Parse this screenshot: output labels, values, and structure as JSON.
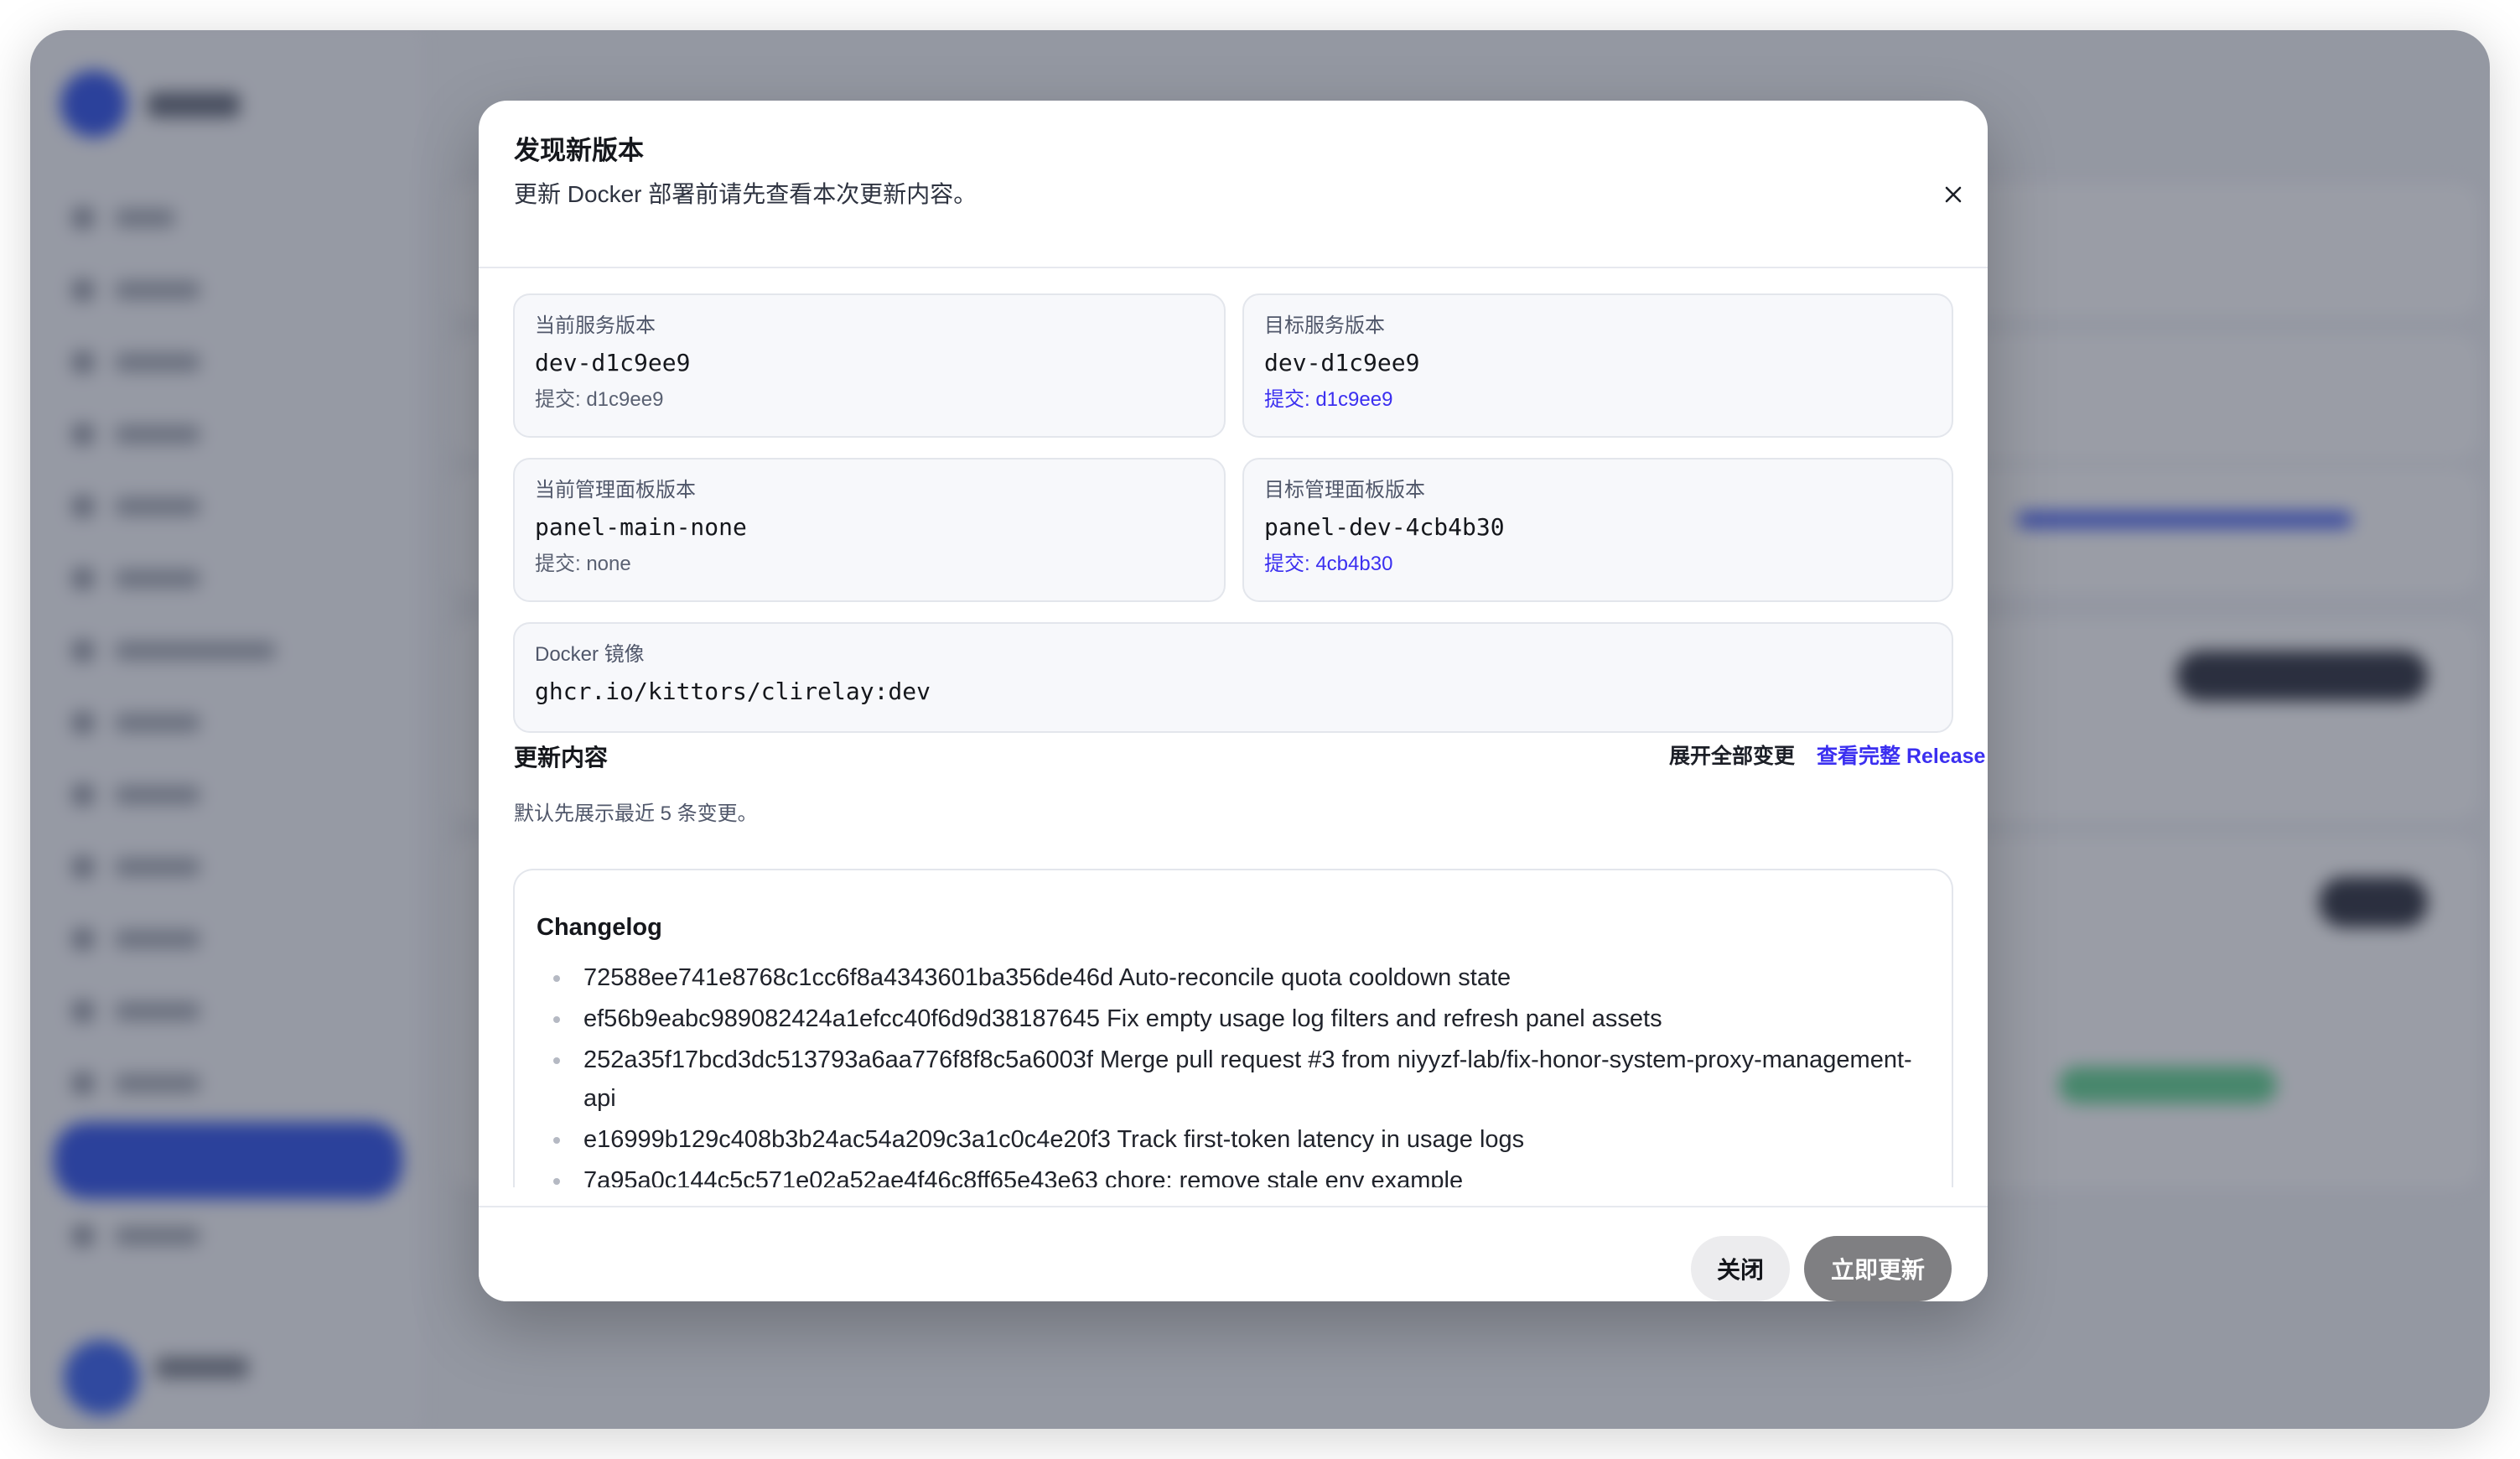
{
  "dialog": {
    "title": "发现新版本",
    "subtitle": "更新 Docker 部署前请先查看本次更新内容。",
    "close_icon": "close-icon"
  },
  "versions": {
    "current_service": {
      "label": "当前服务版本",
      "value": "dev-d1c9ee9",
      "commit": "提交: d1c9ee9"
    },
    "target_service": {
      "label": "目标服务版本",
      "value": "dev-d1c9ee9",
      "commit": "提交: d1c9ee9"
    },
    "current_panel": {
      "label": "当前管理面板版本",
      "value": "panel-main-none",
      "commit": "提交: none"
    },
    "target_panel": {
      "label": "目标管理面板版本",
      "value": "panel-dev-4cb4b30",
      "commit": "提交: 4cb4b30"
    },
    "docker_image": {
      "label": "Docker 镜像",
      "value": "ghcr.io/kittors/clirelay:dev"
    }
  },
  "changes": {
    "section_title": "更新内容",
    "expand_all": "展开全部变更",
    "view_release": "查看完整 Release",
    "hint": "默认先展示最近 5 条变更。",
    "changelog_title": "Changelog",
    "items": [
      "72588ee741e8768c1cc6f8a4343601ba356de46d Auto-reconcile quota cooldown state",
      "ef56b9eabc989082424a1efcc40f6d9d38187645 Fix empty usage log filters and refresh panel assets",
      "252a35f17bcd3dc513793a6aa776f8f8c5a6003f Merge pull request #3 from niyyzf-lab/fix-honor-system-proxy-management-api",
      "e16999b129c408b3b24ac54a209c3a1c0c4e20f3 Track first-token latency in usage logs",
      "7a95a0c144c5c571e02a52ae4f46c8ff65e43e63 chore: remove stale env example"
    ]
  },
  "footer": {
    "close_label": "关闭",
    "update_label": "立即更新"
  },
  "colors": {
    "accent_link": "#3b2ff0",
    "primary_disabled": "#7f7f82",
    "secondary_button": "#ececee",
    "brand_blue": "#2146e8"
  }
}
